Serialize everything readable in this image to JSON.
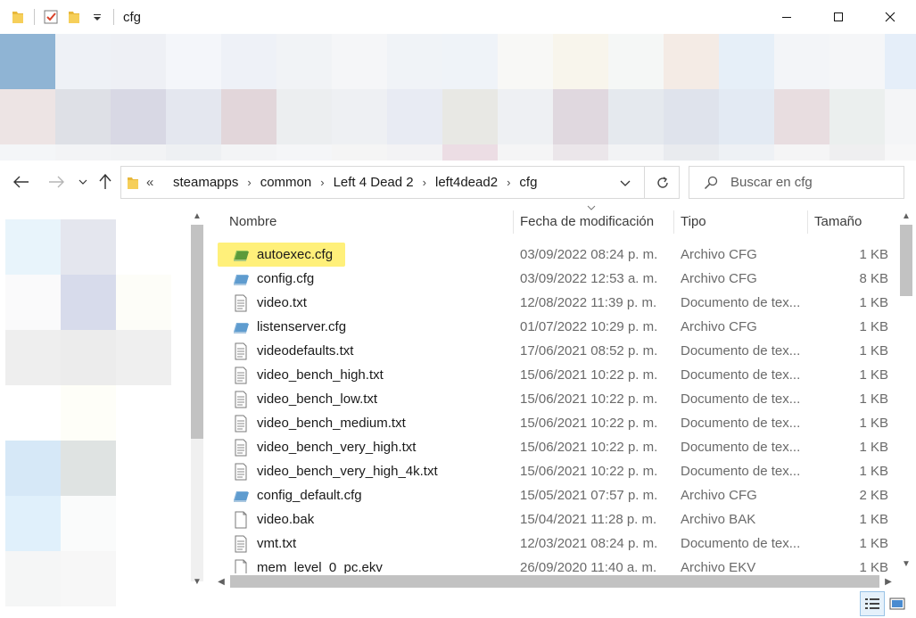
{
  "window": {
    "title": "cfg",
    "colors": {
      "highlight": "#fff07a",
      "accent": "#0078d7"
    }
  },
  "address": {
    "overflow": "«",
    "crumbs": [
      "steamapps",
      "common",
      "Left 4 Dead 2",
      "left4dead2",
      "cfg"
    ]
  },
  "search": {
    "placeholder": "Buscar en cfg"
  },
  "columns": {
    "name": "Nombre",
    "date": "Fecha de modificación",
    "type": "Tipo",
    "size": "Tamaño"
  },
  "files": [
    {
      "name": "autoexec.cfg",
      "date": "03/09/2022 08:24 p. m.",
      "type": "Archivo CFG",
      "size": "1 KB",
      "icon": "cfg-file-icon",
      "highlighted": true
    },
    {
      "name": "config.cfg",
      "date": "03/09/2022 12:53 a. m.",
      "type": "Archivo CFG",
      "size": "8 KB",
      "icon": "cfg-file-icon"
    },
    {
      "name": "video.txt",
      "date": "12/08/2022 11:39 p. m.",
      "type": "Documento de tex...",
      "size": "1 KB",
      "icon": "text-file-icon"
    },
    {
      "name": "listenserver.cfg",
      "date": "01/07/2022 10:29 p. m.",
      "type": "Archivo CFG",
      "size": "1 KB",
      "icon": "cfg-file-icon"
    },
    {
      "name": "videodefaults.txt",
      "date": "17/06/2021 08:52 p. m.",
      "type": "Documento de tex...",
      "size": "1 KB",
      "icon": "text-file-icon"
    },
    {
      "name": "video_bench_high.txt",
      "date": "15/06/2021 10:22 p. m.",
      "type": "Documento de tex...",
      "size": "1 KB",
      "icon": "text-file-icon"
    },
    {
      "name": "video_bench_low.txt",
      "date": "15/06/2021 10:22 p. m.",
      "type": "Documento de tex...",
      "size": "1 KB",
      "icon": "text-file-icon"
    },
    {
      "name": "video_bench_medium.txt",
      "date": "15/06/2021 10:22 p. m.",
      "type": "Documento de tex...",
      "size": "1 KB",
      "icon": "text-file-icon"
    },
    {
      "name": "video_bench_very_high.txt",
      "date": "15/06/2021 10:22 p. m.",
      "type": "Documento de tex...",
      "size": "1 KB",
      "icon": "text-file-icon"
    },
    {
      "name": "video_bench_very_high_4k.txt",
      "date": "15/06/2021 10:22 p. m.",
      "type": "Documento de tex...",
      "size": "1 KB",
      "icon": "text-file-icon"
    },
    {
      "name": "config_default.cfg",
      "date": "15/05/2021 07:57 p. m.",
      "type": "Archivo CFG",
      "size": "2 KB",
      "icon": "cfg-file-icon"
    },
    {
      "name": "video.bak",
      "date": "15/04/2021 11:28 p. m.",
      "type": "Archivo BAK",
      "size": "1 KB",
      "icon": "blank-file-icon"
    },
    {
      "name": "vmt.txt",
      "date": "12/03/2021 08:24 p. m.",
      "type": "Documento de tex...",
      "size": "1 KB",
      "icon": "text-file-icon"
    },
    {
      "name": "mem_level_0_pc.ekv",
      "date": "26/09/2020 11:40 a. m.",
      "type": "Archivo EKV",
      "size": "1 KB",
      "icon": "blank-file-icon"
    }
  ]
}
